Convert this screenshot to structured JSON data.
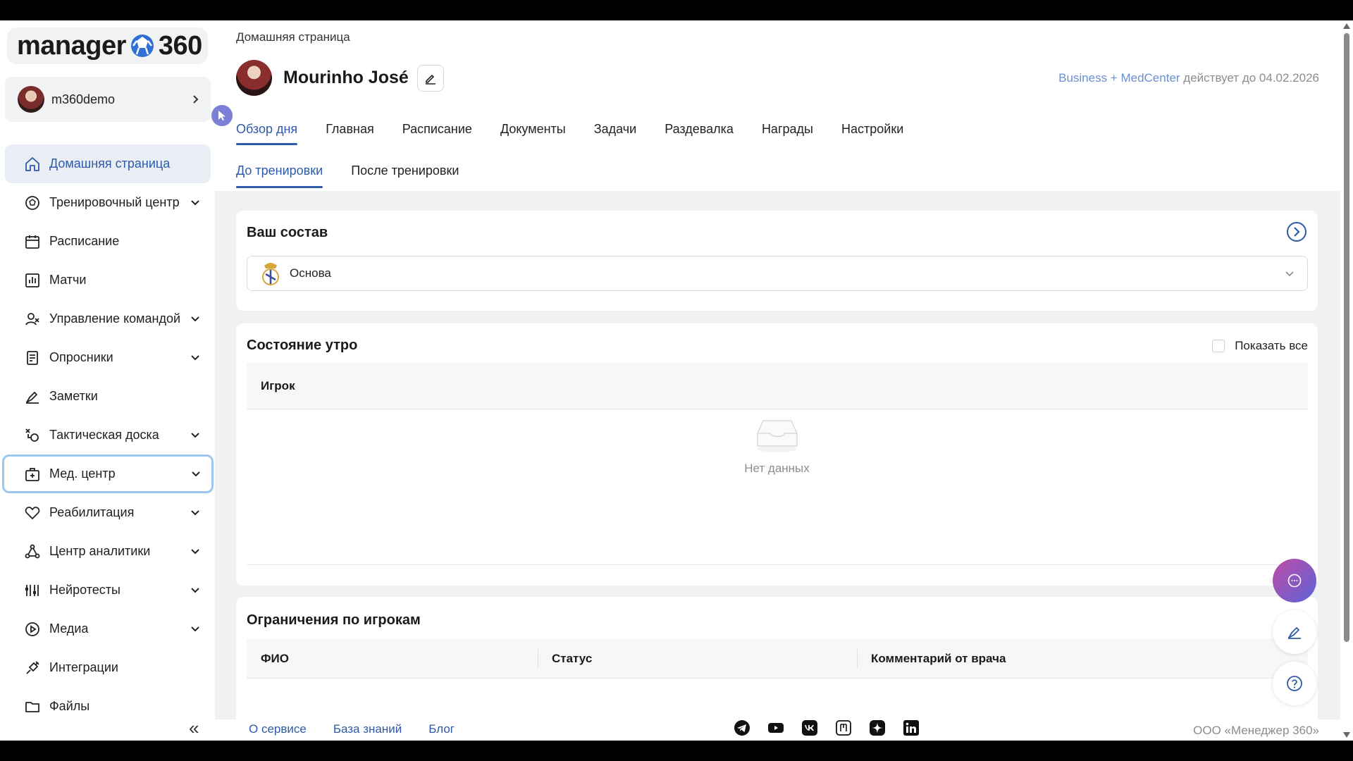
{
  "app": {
    "logo_left": "manager",
    "logo_right": "360",
    "username": "m360demo"
  },
  "sidebar": {
    "items": [
      {
        "label": "Домашняя страница",
        "icon": "home-icon",
        "caret": false
      },
      {
        "label": "Тренировочный центр",
        "icon": "ball-icon",
        "caret": true
      },
      {
        "label": "Расписание",
        "icon": "calendar-icon",
        "caret": false
      },
      {
        "label": "Матчи",
        "icon": "chart-icon",
        "caret": false
      },
      {
        "label": "Управление командой",
        "icon": "team-icon",
        "caret": true
      },
      {
        "label": "Опросники",
        "icon": "survey-icon",
        "caret": true
      },
      {
        "label": "Заметки",
        "icon": "pen-icon",
        "caret": false
      },
      {
        "label": "Тактическая доска",
        "icon": "tactics-icon",
        "caret": true
      },
      {
        "label": "Мед. центр",
        "icon": "medkit-icon",
        "caret": true
      },
      {
        "label": "Реабилитация",
        "icon": "heart-icon",
        "caret": true
      },
      {
        "label": "Центр аналитики",
        "icon": "analytics-icon",
        "caret": true
      },
      {
        "label": "Нейротесты",
        "icon": "sliders-icon",
        "caret": true
      },
      {
        "label": "Медиа",
        "icon": "play-icon",
        "caret": true
      },
      {
        "label": "Интеграции",
        "icon": "plug-icon",
        "caret": false
      },
      {
        "label": "Файлы",
        "icon": "folder-icon",
        "caret": false
      }
    ],
    "collapse_label": "«"
  },
  "header": {
    "breadcrumb": "Домашняя страница",
    "profile_name": "Mourinho José",
    "license_plan": "Business + MedCenter",
    "license_text": "действует до 04.02.2026"
  },
  "tabs": [
    "Обзор дня",
    "Главная",
    "Расписание",
    "Документы",
    "Задачи",
    "Раздевалка",
    "Награды",
    "Настройки"
  ],
  "subtabs": [
    "До тренировки",
    "После тренировки"
  ],
  "squad": {
    "title": "Ваш состав",
    "selected": "Основа"
  },
  "morning": {
    "title": "Состояние утро",
    "show_all": "Показать все",
    "column": "Игрок",
    "empty": "Нет данных"
  },
  "restrictions": {
    "title": "Ограничения по игрокам",
    "columns": [
      "ФИО",
      "Статус",
      "Комментарий от врача"
    ]
  },
  "footer": {
    "links": [
      "О сервисе",
      "База знаний",
      "Блог"
    ],
    "socials": [
      "telegram-icon",
      "youtube-icon",
      "vk-icon",
      "yandex-zen-icon",
      "dzen-icon",
      "linkedin-icon"
    ],
    "copyright": "ООО «Менеджер 360»"
  },
  "colors": {
    "accent": "#2e5aa7",
    "active_bg": "#e9eef5",
    "focus_ring": "#9cc8ef",
    "muted": "#8c8c8c"
  }
}
